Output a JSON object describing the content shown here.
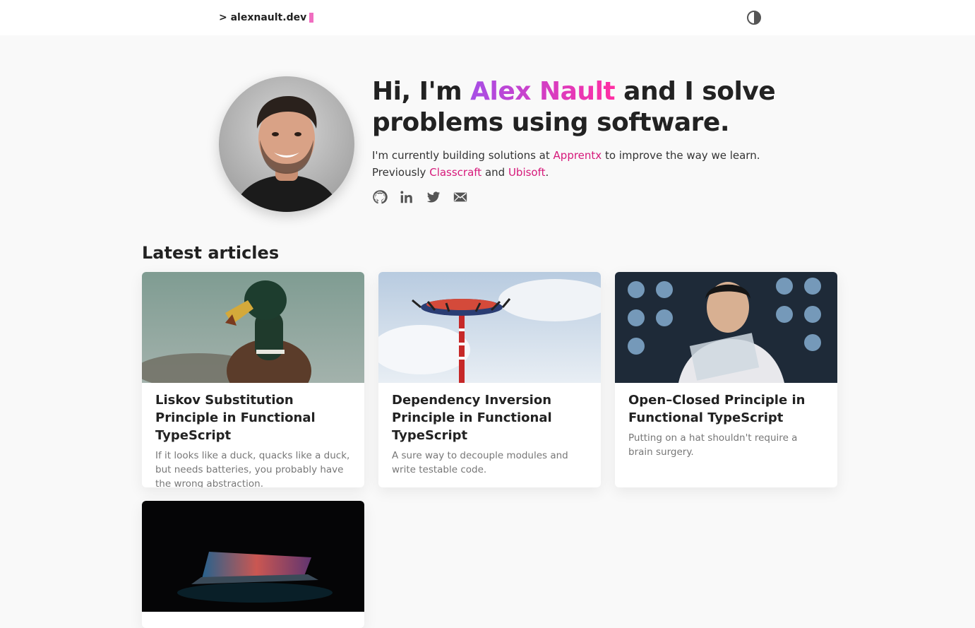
{
  "header": {
    "logo_text": "> alexnault.dev",
    "cursor_color": "#f06ec0",
    "theme_toggle_icon": "contrast-icon"
  },
  "hero": {
    "greeting_prefix": "Hi, I'm ",
    "name": "Alex Nault",
    "greeting_suffix": " and I solve problems using software.",
    "bio_line1_prefix": "I'm currently building solutions at ",
    "employer_current": "Apprentx",
    "bio_line1_suffix": " to improve the way we learn.",
    "bio_line2_prefix": "Previously ",
    "employer_prev1": "Classcraft",
    "bio_line2_and": " and ",
    "employer_prev2": "Ubisoft",
    "bio_line2_suffix": ".",
    "avatar_alt": "Alex Nault portrait",
    "socials": [
      {
        "icon": "github-icon"
      },
      {
        "icon": "linkedin-icon"
      },
      {
        "icon": "twitter-icon"
      },
      {
        "icon": "mail-icon"
      }
    ],
    "link_color": "#d6197a",
    "name_gradient": [
      "#a64ee6",
      "#ff2fa3"
    ]
  },
  "articles_section": {
    "title": "Latest articles",
    "articles": [
      {
        "title": "Liskov Substitution Principle in Functional TypeScript",
        "description": "If it looks like a duck, quacks like a duck, but needs batteries, you probably have the wrong abstraction.",
        "image": "duck-photo"
      },
      {
        "title": "Dependency Inversion Principle in Functional TypeScript",
        "description": "A sure way to decouple modules and write testable code.",
        "image": "amusement-ride-photo"
      },
      {
        "title": "Open–Closed Principle in Functional TypeScript",
        "description": "Putting on a hat shouldn't require a brain surgery.",
        "image": "doctor-xray-photo"
      },
      {
        "title": "",
        "description": "",
        "image": "laptop-dark-photo"
      }
    ]
  }
}
